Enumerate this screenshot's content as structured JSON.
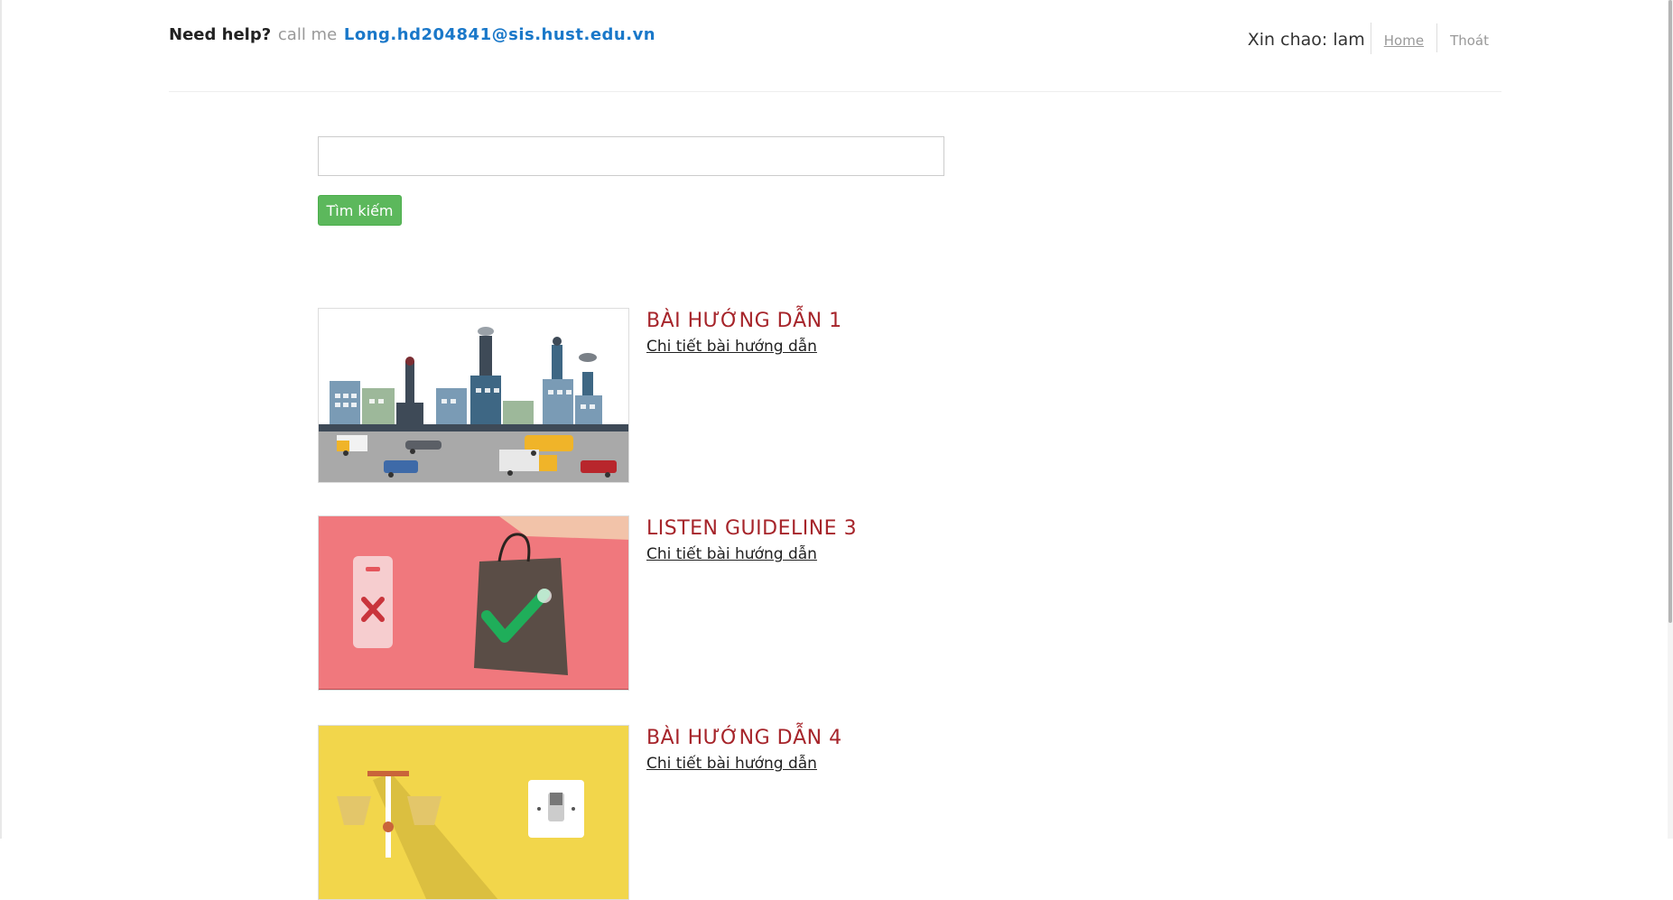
{
  "header": {
    "help_label": "Need help?",
    "call_label": "call me",
    "email": "Long.hd204841@sis.hust.edu.vn",
    "greeting": "Xin chao: lam",
    "home_label": "Home",
    "logout_label": "Thoát"
  },
  "search": {
    "value": "",
    "placeholder": "",
    "button_label": "Tìm kiếm"
  },
  "guides": [
    {
      "title": "BÀI HƯỚNG DẪN 1",
      "link_label": "Chi tiết bài hướng dẫn",
      "thumbnail_icon": "city-pollution-image"
    },
    {
      "title": "LISTEN GUIDELINE 3",
      "link_label": "Chi tiết bài hướng dẫn",
      "thumbnail_icon": "shopping-bag-image"
    },
    {
      "title": "BÀI HƯỚNG DẪN 4",
      "link_label": "Chi tiết bài hướng dẫn",
      "thumbnail_icon": "light-switch-image"
    }
  ],
  "colors": {
    "title": "#a6242a",
    "email": "#1a78c9",
    "button": "#5cb85c"
  }
}
